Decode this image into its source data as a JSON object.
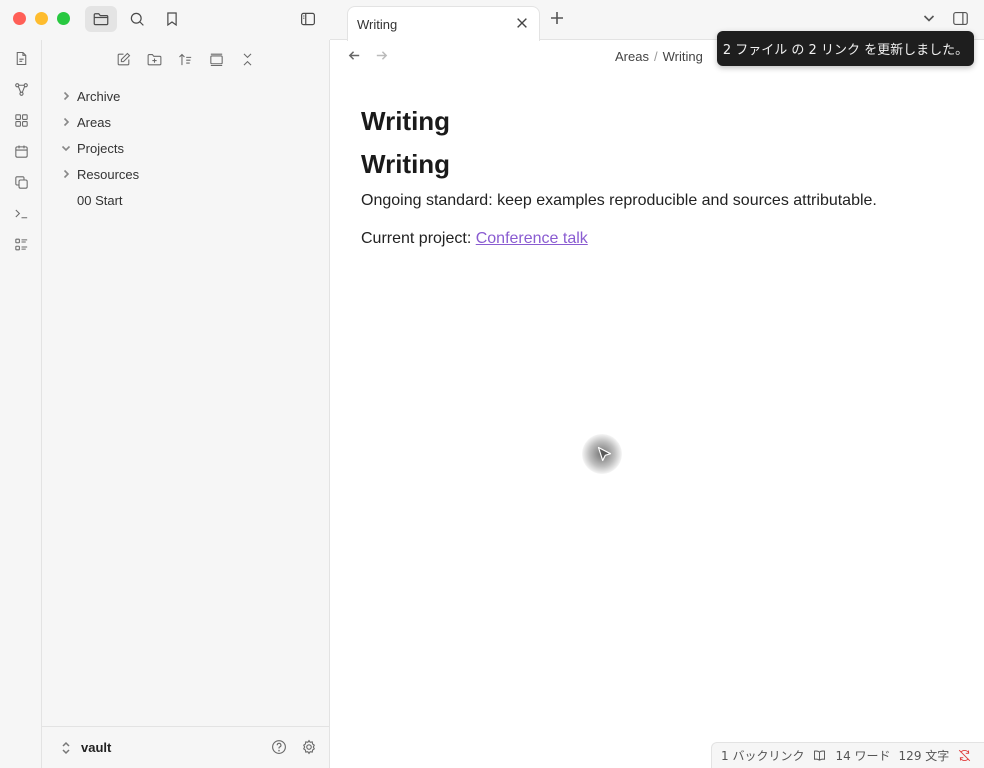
{
  "tab": {
    "title": "Writing"
  },
  "breadcrumb": {
    "parent": "Areas",
    "current": "Writing"
  },
  "notice": {
    "text": "2 ファイル の 2 リンク を更新しました。"
  },
  "sidebar": {
    "tree": [
      {
        "label": "Archive",
        "type": "folder",
        "expanded": false
      },
      {
        "label": "Areas",
        "type": "folder",
        "expanded": false
      },
      {
        "label": "Projects",
        "type": "folder",
        "expanded": true
      },
      {
        "label": "Resources",
        "type": "folder",
        "expanded": false
      },
      {
        "label": "00 Start",
        "type": "file"
      }
    ],
    "vault_name": "vault"
  },
  "note": {
    "heading1": "Writing",
    "heading2": "Writing",
    "paragraph": "Ongoing standard: keep examples reproducible and sources attributable.",
    "project_prefix": "Current project: ",
    "project_link": "Conference talk"
  },
  "statusbar": {
    "backlinks": "1 バックリンク",
    "words": "14 ワード",
    "chars": "129 文字"
  },
  "colors": {
    "link": "#8a5cd1",
    "notice_bg": "#1e1e1e",
    "sync_error": "#e03c3c"
  }
}
